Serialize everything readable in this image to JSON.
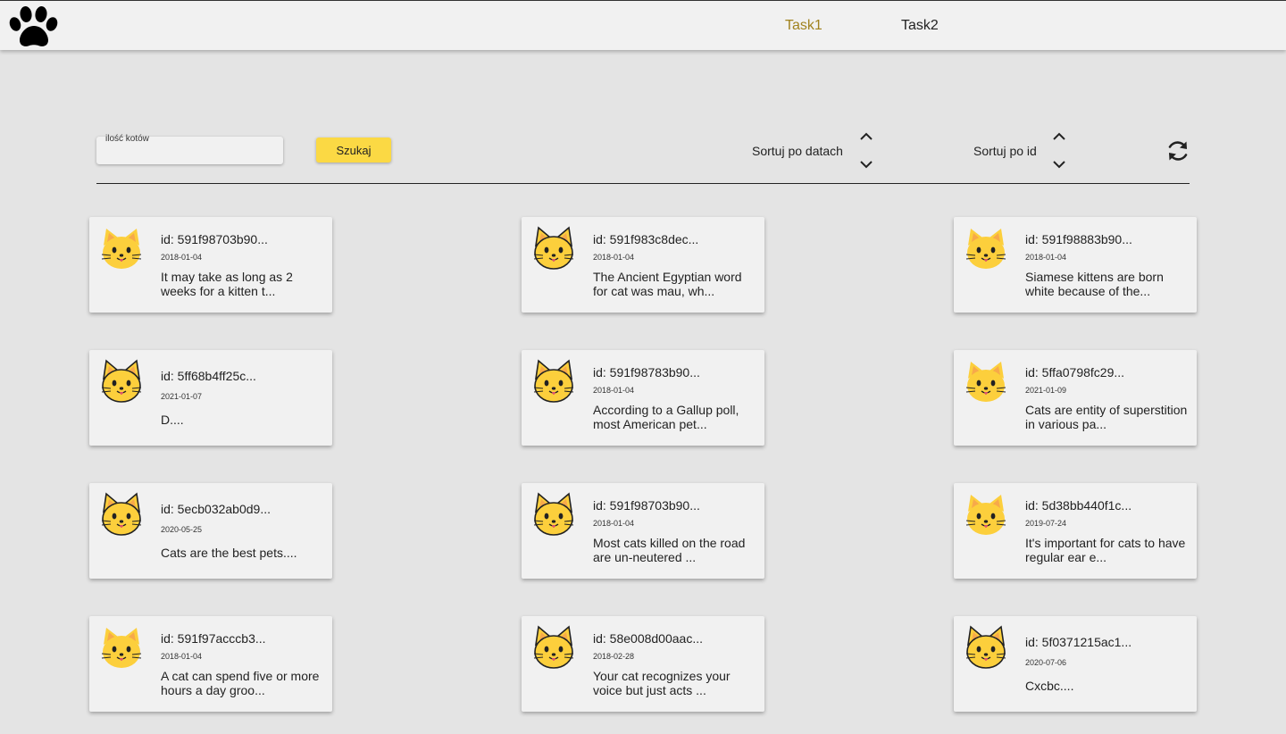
{
  "header": {
    "logo_icon": "paw-icon",
    "nav": [
      {
        "label": "Task1",
        "active": true
      },
      {
        "label": "Task2",
        "active": false
      }
    ],
    "active_color": "#a0821e"
  },
  "toolbar": {
    "search_label": "ilość kotów",
    "search_value": "",
    "search_button": "Szukaj",
    "sort_date_label": "Sortuj po datach",
    "sort_id_label": "Sortuj po id",
    "accent": "#fbd944"
  },
  "cards": [
    {
      "id": "id: 591f98703b90...",
      "date": "2018-01-04",
      "text": "It may take as long as 2 weeks for a kitten t...",
      "icon": "cat-face-icon"
    },
    {
      "id": "id: 591f983c8dec...",
      "date": "2018-01-04",
      "text": "The Ancient Egyptian word for cat was mau, wh...",
      "icon": "cat-face-icon"
    },
    {
      "id": "id: 591f98883b90...",
      "date": "2018-01-04",
      "text": "Siamese kittens are born white because of the...",
      "icon": "cat-face-icon"
    },
    {
      "id": "id: 5ff68b4ff25c...",
      "date": "2021-01-07",
      "text": "D....",
      "icon": "cat-face-icon"
    },
    {
      "id": "id: 591f98783b90...",
      "date": "2018-01-04",
      "text": "According to a Gallup poll, most American pet...",
      "icon": "cat-face-icon"
    },
    {
      "id": "id: 5ffa0798fc29...",
      "date": "2021-01-09",
      "text": "Cats are entity of superstition in various pa...",
      "icon": "cat-face-icon"
    },
    {
      "id": "id: 5ecb032ab0d9...",
      "date": "2020-05-25",
      "text": "Cats are the best pets....",
      "icon": "cat-face-icon"
    },
    {
      "id": "id: 591f98703b90...",
      "date": "2018-01-04",
      "text": "Most cats killed on the road are un-neutered ...",
      "icon": "cat-face-icon"
    },
    {
      "id": "id: 5d38bb440f1c...",
      "date": "2019-07-24",
      "text": "It's important for cats to have regular ear e...",
      "icon": "cat-face-icon"
    },
    {
      "id": "id: 591f97acccb3...",
      "date": "2018-01-04",
      "text": "A cat can spend five or more hours a day groo...",
      "icon": "cat-face-icon"
    },
    {
      "id": "id: 58e008d00aac...",
      "date": "2018-02-28",
      "text": "Your cat recognizes your voice but just acts ...",
      "icon": "cat-face-icon"
    },
    {
      "id": "id: 5f0371215ac1...",
      "date": "2020-07-06",
      "text": "Cxcbc....",
      "icon": "cat-face-icon"
    }
  ]
}
